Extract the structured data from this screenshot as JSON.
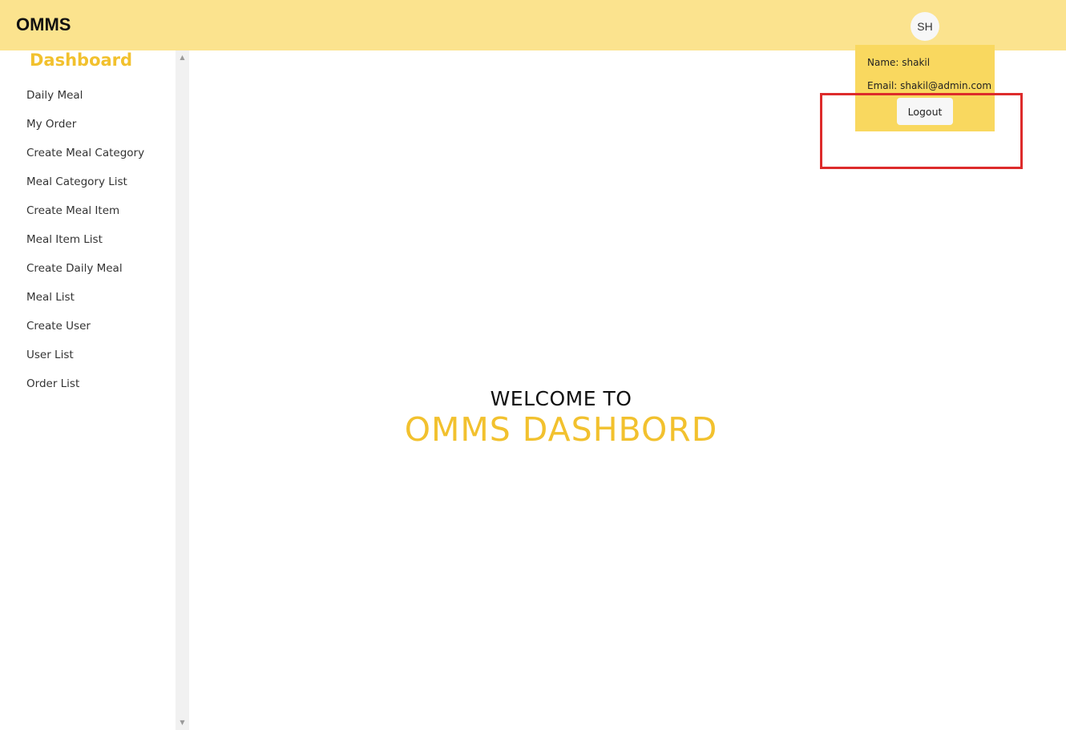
{
  "header": {
    "brand": "OMMS",
    "avatar_initials": "SH"
  },
  "sidebar": {
    "title": "Dashboard",
    "items": [
      {
        "label": "Daily Meal"
      },
      {
        "label": "My Order"
      },
      {
        "label": "Create Meal Category"
      },
      {
        "label": "Meal Category List"
      },
      {
        "label": "Create Meal Item"
      },
      {
        "label": "Meal Item List"
      },
      {
        "label": "Create Daily Meal"
      },
      {
        "label": "Meal List"
      },
      {
        "label": "Create User"
      },
      {
        "label": "User List"
      },
      {
        "label": "Order List"
      }
    ]
  },
  "profile_dropdown": {
    "name": "Name: shakil",
    "email": "Email: shakil@admin.com",
    "logout_label": "Logout"
  },
  "main": {
    "welcome_line1": "WELCOME TO",
    "welcome_line2": "OMMS DASHBORD"
  },
  "colors": {
    "header_bg": "#fbe38e",
    "dropdown_bg": "#f9d85f",
    "accent": "#f2c12e",
    "highlight_border": "#dd2b2b"
  },
  "icons": {
    "scroll_up": "scroll-up-arrow-icon",
    "scroll_down": "scroll-down-arrow-icon"
  }
}
